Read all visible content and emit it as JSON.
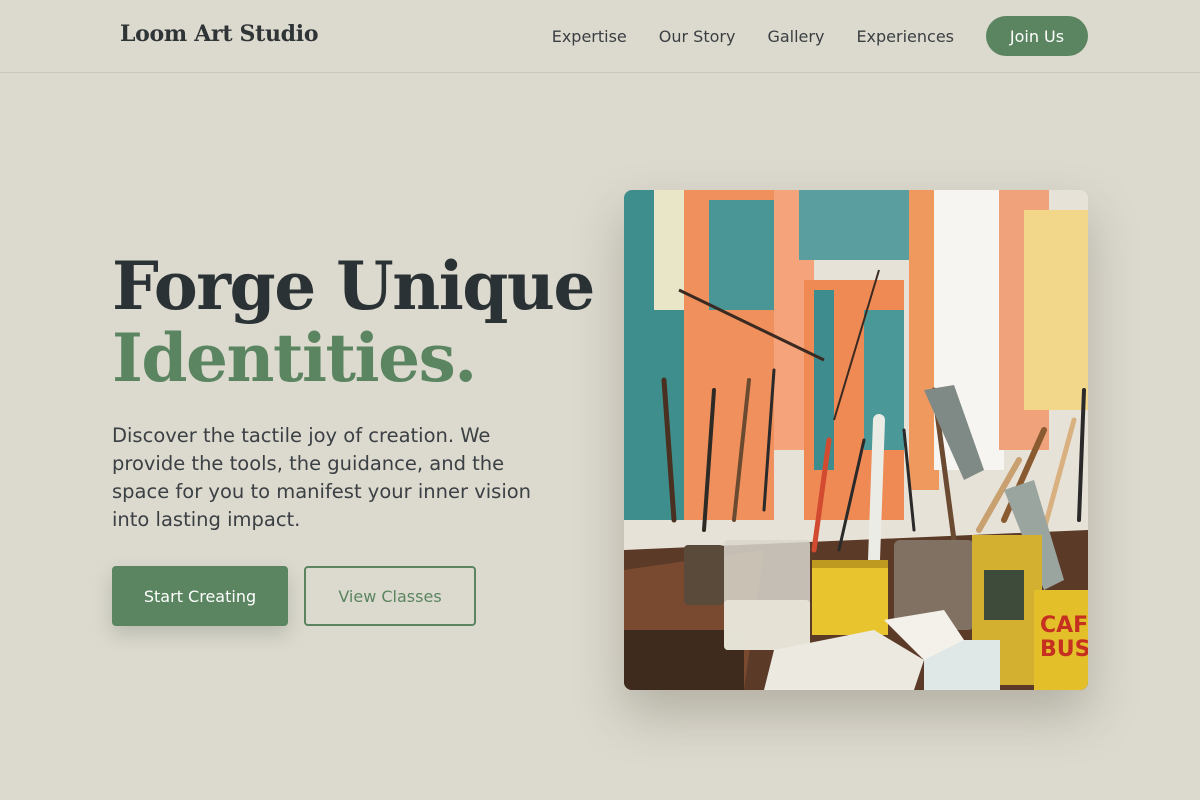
{
  "header": {
    "brand": "Loom Art Studio",
    "nav": [
      "Expertise",
      "Our Story",
      "Gallery",
      "Experiences"
    ],
    "cta": "Join Us"
  },
  "hero": {
    "title_line1": "Forge Unique",
    "title_line2": "Identities.",
    "description": "Discover the tactile joy of creation. We provide the tools, the guidance, and the space for you to manifest your inner vision into lasting impact.",
    "primary_button": "Start Creating",
    "secondary_button": "View Classes",
    "image": {
      "label": "CAFE BUST"
    }
  },
  "colors": {
    "background": "#dcd9ce",
    "accent": "#5a8560",
    "text_dark": "#2b3235"
  }
}
